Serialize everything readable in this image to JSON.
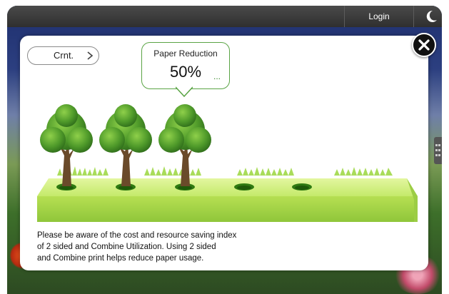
{
  "topbar": {
    "login_label": "Login",
    "moon_icon": "moon-icon"
  },
  "dialog": {
    "current_button_label": "Crnt.",
    "indicator": {
      "title": "Paper Reduction",
      "value": "50%",
      "more": "...",
      "level_percent": 50
    },
    "trees": {
      "total": 5,
      "standing": 3
    },
    "info_lines": [
      "Please be aware of the cost and resource saving index",
      "of 2 sided and Combine Utilization. Using 2 sided",
      "and Combine print helps reduce paper usage."
    ]
  },
  "colors": {
    "accent_green": "#5aa445",
    "platform_green": "#b7e35a",
    "close_bg": "#111111"
  }
}
